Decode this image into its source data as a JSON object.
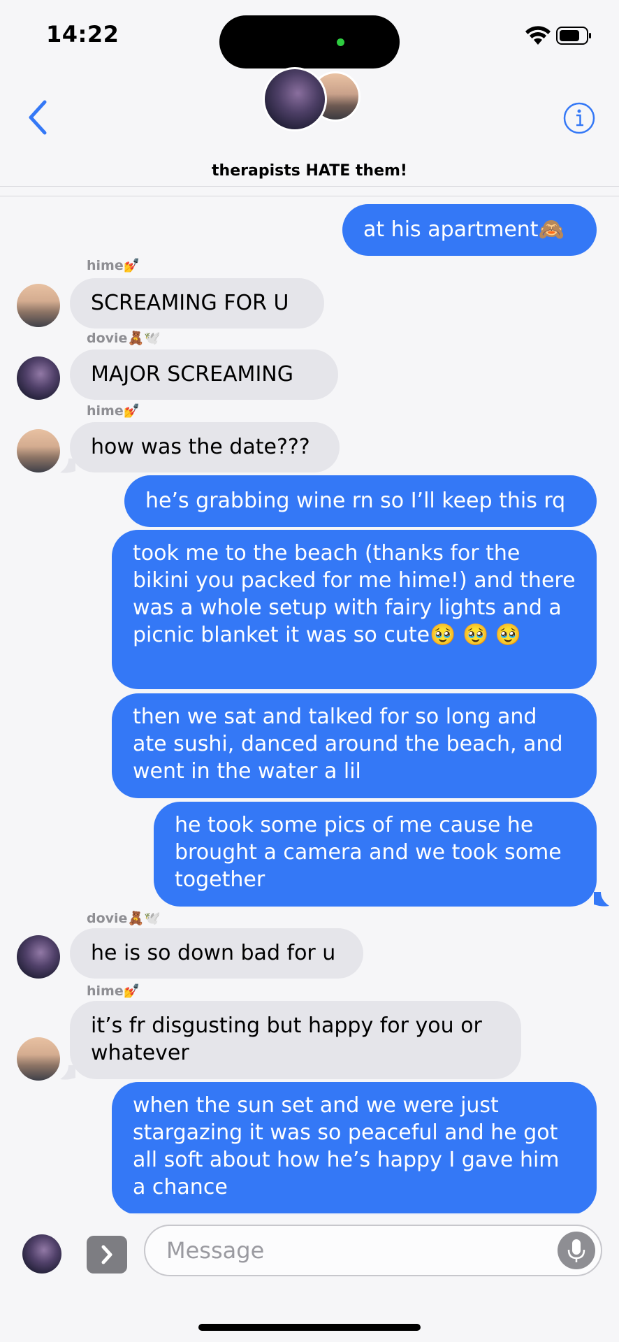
{
  "status": {
    "time": "14:22"
  },
  "header": {
    "group_name": "therapists HATE them!"
  },
  "messages": [
    {
      "text": "at his apartment🙈"
    },
    {
      "sender": "hime💅",
      "text": "SCREAMING FOR U"
    },
    {
      "sender": "dovie🧸🕊️",
      "text": "MAJOR SCREAMING"
    },
    {
      "sender": "hime💅",
      "text": "how was the date???"
    },
    {
      "text": "he’s grabbing wine rn so I’ll keep this rq"
    },
    {
      "text": "took me to the beach (thanks for the bikini you packed for me hime!) and there was a whole setup with fairy lights and a picnic blanket it was so cute🥹 🥹 🥹"
    },
    {
      "text": "then we sat and talked for so long and ate sushi, danced around the beach, and went in the water a lil"
    },
    {
      "text": "he took some pics of me cause he brought a camera and we took some together"
    },
    {
      "sender": "dovie🧸🕊️",
      "text": "he is so down bad for u"
    },
    {
      "sender": "hime💅",
      "text": "it’s fr disgusting but happy for you or whatever"
    },
    {
      "text": "when the sun set and we were just stargazing it was so peaceful and he got all soft about how he’s happy I gave him a chance"
    }
  ],
  "composer": {
    "placeholder": "Message"
  },
  "colors": {
    "accent": "#3478f6",
    "incoming": "#e5e5ea"
  }
}
